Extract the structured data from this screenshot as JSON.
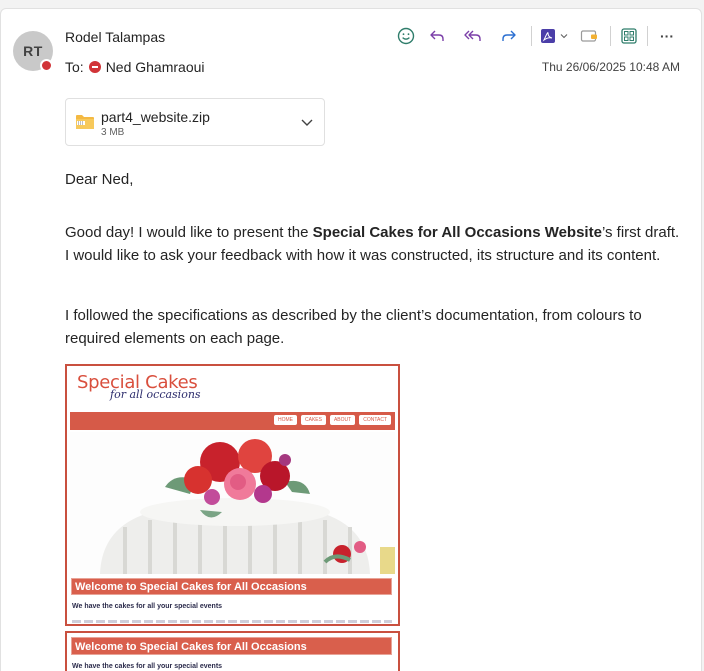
{
  "email": {
    "sender_initials": "RT",
    "sender_name": "Rodel Talampas",
    "to_label": "To:",
    "recipient": "Ned Ghamraoui",
    "timestamp": "Thu 26/06/2025 10:48 AM"
  },
  "toolbar": {
    "icons": [
      "emoji-icon",
      "reply-icon",
      "reply-all-icon",
      "forward-icon",
      "pdf-icon",
      "chevron-down-icon",
      "immersive-reader-icon",
      "apps-icon",
      "more-icon"
    ],
    "more_label": "···"
  },
  "attachment": {
    "name": "part4_website.zip",
    "size": "3 MB"
  },
  "body": {
    "greeting": "Dear Ned,",
    "p1_before": "Good day! I would like to present the ",
    "p1_bold": "Special Cakes for All Occasions Website",
    "p1_after": "’s first draft. I would like to ask your feedback with how it was constructed, its structure and its content.",
    "p2": "I followed the specifications as described by the client’s documentation, from colours to required elements on each page."
  },
  "preview": {
    "logo_line1": "Special Cakes",
    "logo_line2": "for all occasions",
    "nav": [
      "HOME",
      "CAKES",
      "ABOUT",
      "CONTACT"
    ],
    "banner": "Welcome to Special Cakes for All Occasions",
    "tagline": "We have the cakes for all your special events"
  },
  "colors": {
    "accent": "#d65a48",
    "presence_busy": "#d13438",
    "toolbar_icon": "#2f7d6b"
  }
}
